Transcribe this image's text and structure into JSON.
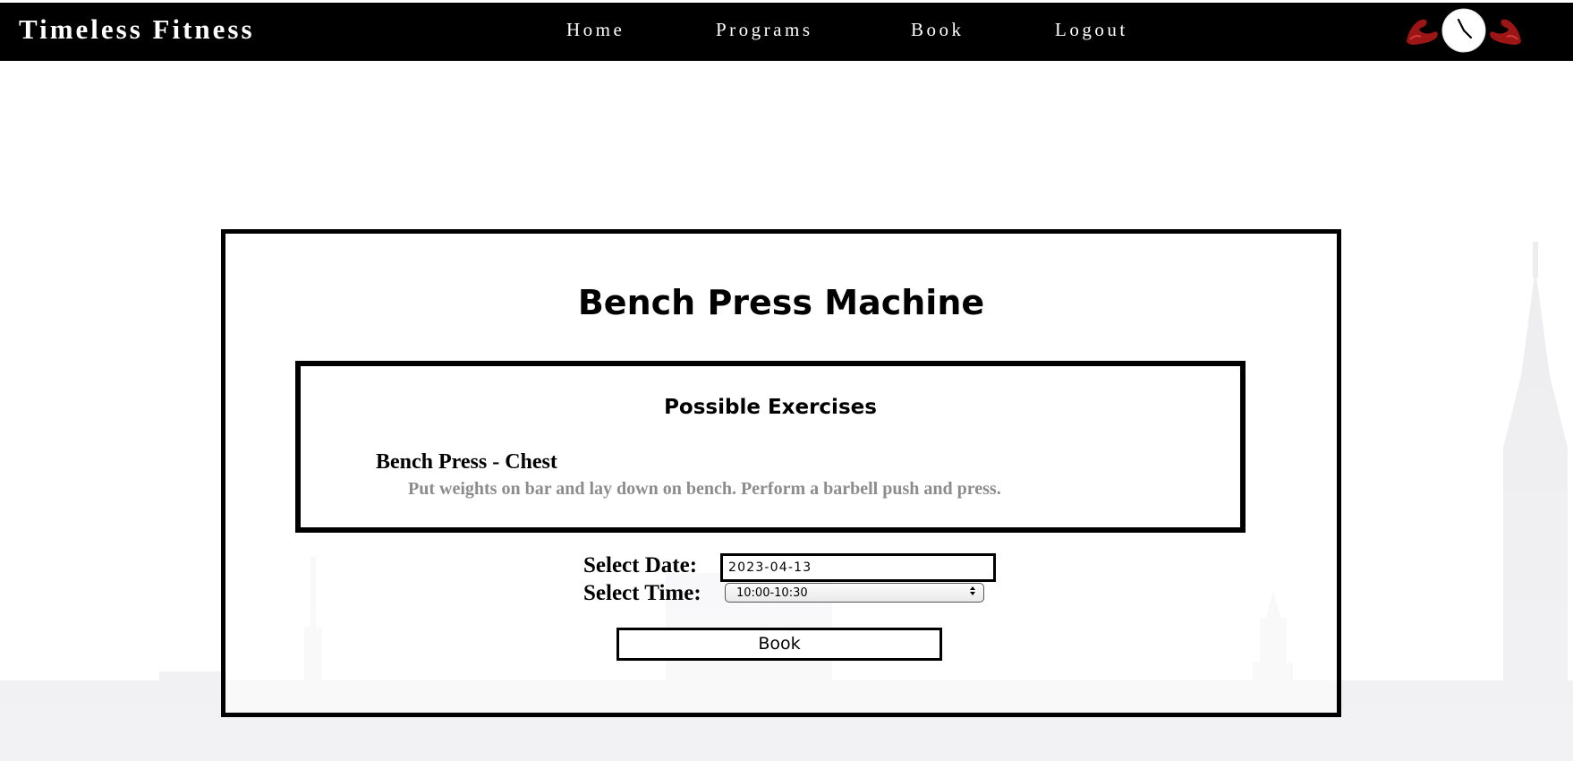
{
  "navbar": {
    "brand": "Timeless Fitness",
    "links": [
      {
        "label": "Home"
      },
      {
        "label": "Programs"
      },
      {
        "label": "Book"
      },
      {
        "label": "Logout"
      }
    ]
  },
  "machine": {
    "title": "Bench Press Machine",
    "exercises_heading": "Possible Exercises",
    "exercises": [
      {
        "name": "Bench Press - Chest",
        "description": "Put weights on bar and lay down on bench. Perform a barbell push and press."
      }
    ]
  },
  "booking": {
    "date_label": "Select Date:",
    "date_value": "2023-04-13",
    "time_label": "Select Time:",
    "time_value": "10:00-10:30",
    "book_button": "Book"
  },
  "colors": {
    "navbar_bg": "#000000",
    "navbar_text": "#ffffff",
    "description_text": "#8c8c8c",
    "logo_accent": "#b01818"
  },
  "icons": {
    "logo": "flexing-arms-clock-icon",
    "select_arrows": "updown-chevron-icon"
  }
}
